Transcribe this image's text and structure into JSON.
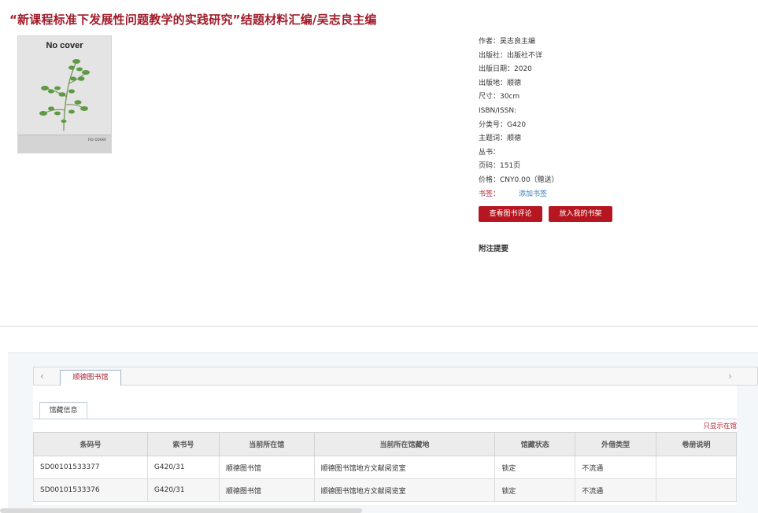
{
  "book": {
    "title": "“新课程标准下发展性问题教学的实践研究”结题材料汇编/吴志良主编",
    "cover": {
      "top_text": "No cover",
      "bottom_text": "no cover"
    }
  },
  "meta": {
    "author": "作者：吴志良主编",
    "publisher": "出版社：出版社不详",
    "pub_date": "出版日期：2020",
    "pub_place": "出版地：顺德",
    "size": "尺寸：30cm",
    "isbn": "ISBN/ISSN:",
    "class_no": "分类号：G420",
    "subject": "主题词：顺德",
    "series": "丛书：",
    "pages": "页码：151页",
    "price": "价格：CNY0.00（赠送）",
    "tag_label": "书签：",
    "tag_add": "添加书签"
  },
  "actions": {
    "review_label": "查看图书评论",
    "shelf_label": "放入我的书架"
  },
  "notes_title": "附注提要",
  "holdings": {
    "library_tab": "顺德图书馆",
    "subtab": "馆藏信息",
    "only_show": "只显示在馆",
    "columns": [
      "条码号",
      "索书号",
      "当前所在馆",
      "当前所在馆藏地",
      "馆藏状态",
      "外借类型",
      "卷册说明"
    ],
    "rows": [
      [
        "SD00101533377",
        "G420/31",
        "顺德图书馆",
        "顺德图书馆地方文献阅览室",
        "锁定",
        "不流通",
        ""
      ],
      [
        "SD00101533376",
        "G420/31",
        "顺德图书馆",
        "顺德图书馆地方文献阅览室",
        "锁定",
        "不流通",
        ""
      ]
    ]
  },
  "icons": {
    "prev": "chevron-left-icon",
    "next": "chevron-right-icon"
  },
  "colors": {
    "accent": "#b5161f",
    "title": "#a01c2a",
    "link": "#3b7bbf"
  }
}
